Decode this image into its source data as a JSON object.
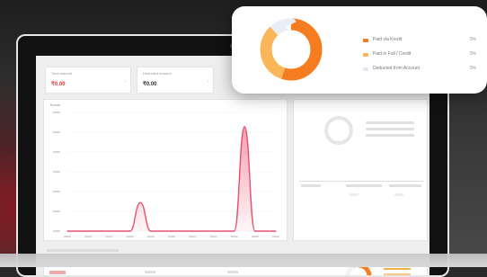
{
  "colors": {
    "accent_orange": "#f57c1f",
    "accent_light_orange": "#fbb65a",
    "line_pink": "#e8506e",
    "donut_gray": "#e9eef6"
  },
  "dashboard": {
    "stat_cards": [
      {
        "label": "Total amount",
        "value": "₹0.00"
      },
      {
        "label": "Deducted amount",
        "value": "₹0.00"
      }
    ],
    "chart_panel_title": "Trends"
  },
  "chart_data": {
    "type": "line",
    "series": [
      {
        "values": [
          0,
          0,
          0,
          0,
          0,
          0,
          0,
          1.2,
          0,
          0,
          0,
          0,
          0,
          0,
          0,
          0,
          0,
          4.4,
          0,
          0,
          0
        ]
      }
    ],
    "ylim": [
      0,
      5
    ],
    "grid": true,
    "legend": "none"
  },
  "donut": {
    "slices": [
      {
        "label": "Paid via Kredit",
        "percent": 0,
        "share": 0.55,
        "color": "#f57c1f"
      },
      {
        "label": "Paid in Full / Credit",
        "percent": 0,
        "share": 0.33,
        "color": "#fbb65a"
      },
      {
        "label": "Deducted from Account",
        "percent": 0,
        "share": 0.12,
        "color": "#e9eef6"
      }
    ],
    "legend_pct_text": "0%"
  }
}
